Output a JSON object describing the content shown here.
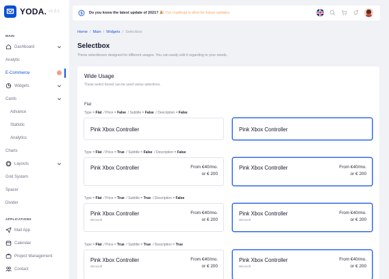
{
  "app": {
    "logo_text": "YODA.",
    "logo_version": "v1.0.1"
  },
  "sidebar": {
    "section_main": "MAIN",
    "items": [
      {
        "label": "Dashboard"
      },
      {
        "label": "Analytic"
      },
      {
        "label": "E-Commerce"
      },
      {
        "label": "Widgets"
      },
      {
        "label": "Cards"
      },
      {
        "label": "Advance"
      },
      {
        "label": "Statistic"
      },
      {
        "label": "Analytics"
      },
      {
        "label": "Charts"
      },
      {
        "label": "Layouts"
      },
      {
        "label": "Grid System"
      },
      {
        "label": "Spacer"
      },
      {
        "label": "Divider"
      }
    ],
    "section_apps": "APPLICATIONS",
    "apps": [
      {
        "label": "Mail App"
      },
      {
        "label": "Calendar"
      },
      {
        "label": "Project Management"
      },
      {
        "label": "Contact"
      }
    ]
  },
  "topbar": {
    "message": "Do you know the latest update of 2021? 🎉",
    "message_link": "Our roadmap is alive for future updates."
  },
  "breadcrumb": [
    "Home",
    "Main",
    "Widgets",
    "Selectbox"
  ],
  "page": {
    "title": "Selectbox",
    "description": "These selectboxes designed for different usages. You can easily edit it regarding to your needs."
  },
  "card": {
    "title": "Wide Usage",
    "subtitle": "These select boxed can be used varius selections.",
    "group_title": "Flat",
    "rows": [
      {
        "label_prefix": "Type = ",
        "label_type": "Flat",
        "label_price": "Price = ",
        "label_price_val": "False",
        "label_subtitle": "Subtitle = ",
        "label_subtitle_val": "False",
        "label_desc": "Description = ",
        "label_desc_val": "False"
      },
      {
        "label_prefix": "Type = ",
        "label_type": "Flat",
        "label_price": "Price = ",
        "label_price_val": "True",
        "label_subtitle": "Subtitle = ",
        "label_subtitle_val": "False",
        "label_desc": "Description = ",
        "label_desc_val": "False"
      },
      {
        "label_prefix": "Type = ",
        "label_type": "Flat",
        "label_price": "Price = ",
        "label_price_val": "True",
        "label_subtitle": "Subtitle = ",
        "label_subtitle_val": "True",
        "label_desc": "Description = ",
        "label_desc_val": "False"
      },
      {
        "label_prefix": "Type = ",
        "label_type": "Flat",
        "label_price": "Price = ",
        "label_price_val": "True",
        "label_subtitle": "Subtitle = ",
        "label_subtitle_val": "True",
        "label_desc": "Description = ",
        "label_desc_val": "True"
      }
    ],
    "product_name": "Pink Xbox Controller",
    "product_brand": "Microsoft",
    "price_monthly": "From €40/mo.",
    "price_full": "or € 200"
  },
  "colors": {
    "accent": "#1052d8",
    "selected_border": "#2f6bea",
    "page_bg": "#f1f2f6",
    "highlight_link": "#f5a46a",
    "badge": "#f59e8c"
  }
}
